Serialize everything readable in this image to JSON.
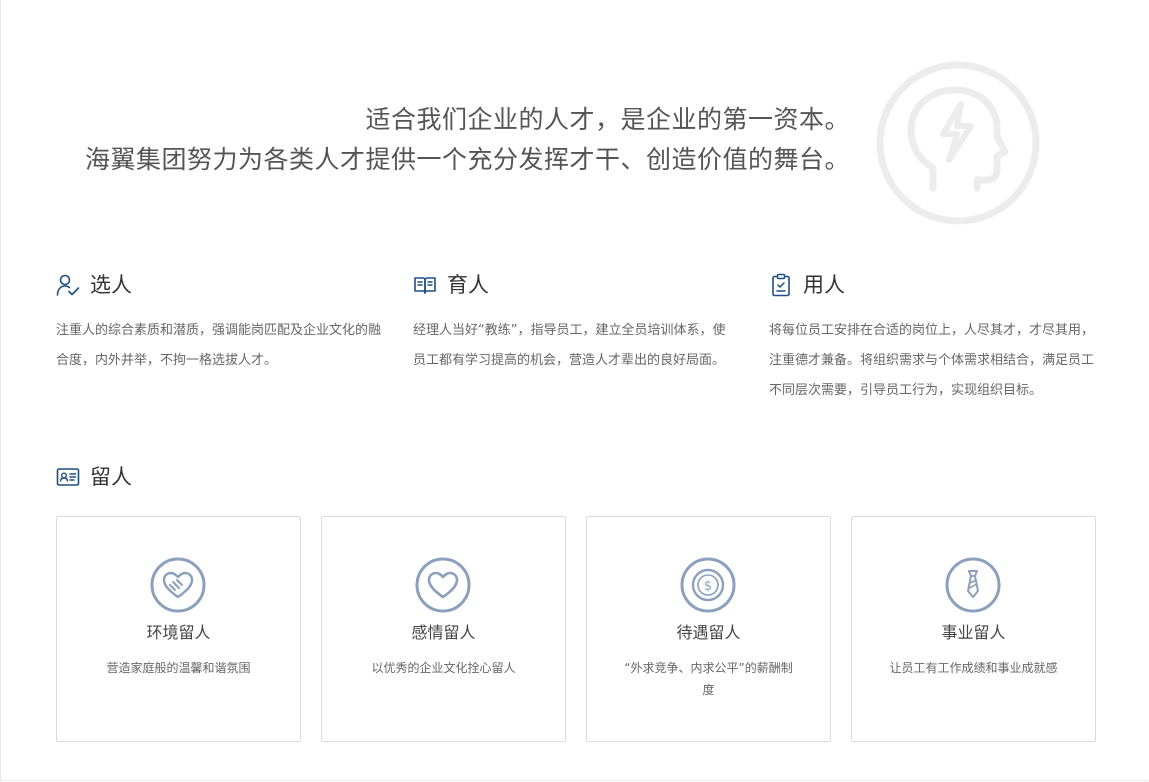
{
  "hero": {
    "line1": "适合我们企业的人才，是企业的第一资本。",
    "line2": "海翼集团努力为各类人才提供一个充分发挥才干、创造价值的舞台。"
  },
  "sections": [
    {
      "title": "选人",
      "icon": "user-check-icon",
      "desc": "注重人的综合素质和潜质，强调能岗匹配及企业文化的融合度，内外并举，不拘一格选拔人才。"
    },
    {
      "title": "育人",
      "icon": "open-book-icon",
      "desc": "经理人当好“教练”，指导员工，建立全员培训体系，使员工都有学习提高的机会，营造人才辈出的良好局面。"
    },
    {
      "title": "用人",
      "icon": "clipboard-icon",
      "desc": "将每位员工安排在合适的岗位上，人尽其才，才尽其用，注重德才兼备。将组织需求与个体需求相结合，满足员工不同层次需要，引导员工行为，实现组织目标。"
    }
  ],
  "retain": {
    "title": "留人",
    "icon": "id-card-icon"
  },
  "cards": [
    {
      "title": "环境留人",
      "desc": "营造家庭般的温馨和谐氛围",
      "icon": "handshake-heart-icon"
    },
    {
      "title": "感情留人",
      "desc": "以优秀的企业文化拴心留人",
      "icon": "heart-icon"
    },
    {
      "title": "待遇留人",
      "desc": "“外求竞争、内求公平”的薪酬制度",
      "icon": "dollar-coin-icon"
    },
    {
      "title": "事业留人",
      "desc": "让员工有工作成绩和事业成就感",
      "icon": "necktie-icon"
    }
  ],
  "colors": {
    "accent": "#1f4f82",
    "card_icon": "#8aa0bd",
    "hero_mark": "#ececec"
  }
}
